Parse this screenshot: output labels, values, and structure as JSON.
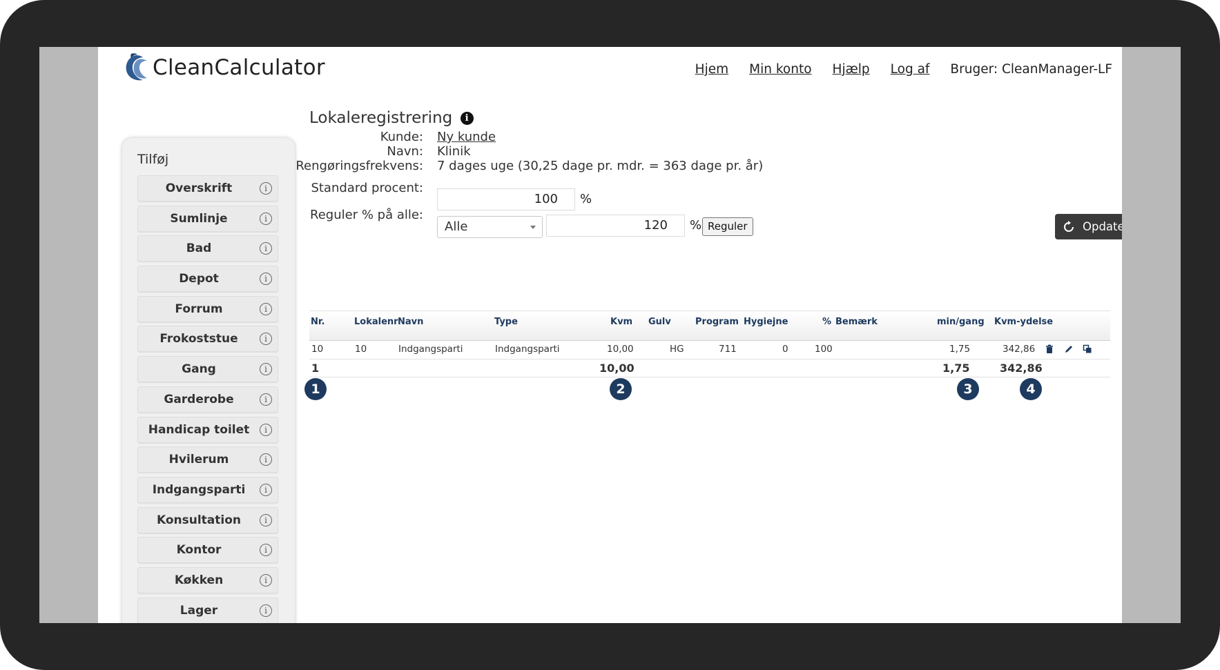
{
  "app": {
    "logo_text": "CleanCalculator"
  },
  "nav": {
    "items": [
      "Hjem",
      "Min konto",
      "Hjælp",
      "Log af"
    ],
    "user_label": "Bruger: CleanManager-LF"
  },
  "sidebar": {
    "title": "Tilføj",
    "items": [
      "Overskrift",
      "Sumlinje",
      "Bad",
      "Depot",
      "Forrum",
      "Frokoststue",
      "Gang",
      "Garderobe",
      "Handicap toilet",
      "Hvilerum",
      "Indgangsparti",
      "Konsultation",
      "Kontor",
      "Køkken",
      "Lager"
    ],
    "info_glyph": "i"
  },
  "page": {
    "title": "Lokaleregistrering",
    "title_icon": "i",
    "customer_label": "Kunde:",
    "customer_value": "Ny kunde",
    "name_label": "Navn:",
    "name_value": "Klinik",
    "freq_label": "Rengøringsfrekvens:",
    "freq_value": "7 dages uge (30,25 dage pr. mdr. = 363 dage pr. år)",
    "std_pct_label": "Standard procent:",
    "std_pct_value": "100",
    "pct_sign": "%",
    "adjust_label": "Reguler % på alle:",
    "adjust_select": "Alle",
    "adjust_value": "120",
    "adjust_button": "Reguler",
    "update_button": "Opdater"
  },
  "table": {
    "headers": [
      "Nr.",
      "Lokalenr",
      "Navn",
      "Type",
      "Kvm",
      "Gulv",
      "Program",
      "Hygiejne",
      "%",
      "Bemærk",
      "min/gang",
      "Kvm-ydelse"
    ],
    "rows": [
      {
        "nr": "10",
        "lokalenr": "10",
        "navn": "Indgangsparti",
        "type": "Indgangsparti",
        "kvm": "10,00",
        "gulv": "HG",
        "program": "711",
        "hygiejne": "0",
        "pct": "100",
        "bemaerk": "",
        "min_gang": "1,75",
        "kvm_ydelse": "342,86"
      }
    ],
    "totals": {
      "count": "1",
      "kvm": "10,00",
      "min_gang": "1,75",
      "kvm_ydelse": "342,86"
    }
  },
  "badges": [
    "1",
    "2",
    "3",
    "4"
  ],
  "colors": {
    "accent": "#1e3a5f",
    "dark_button": "#3a3a3a",
    "logo": "#2e5a8f"
  }
}
